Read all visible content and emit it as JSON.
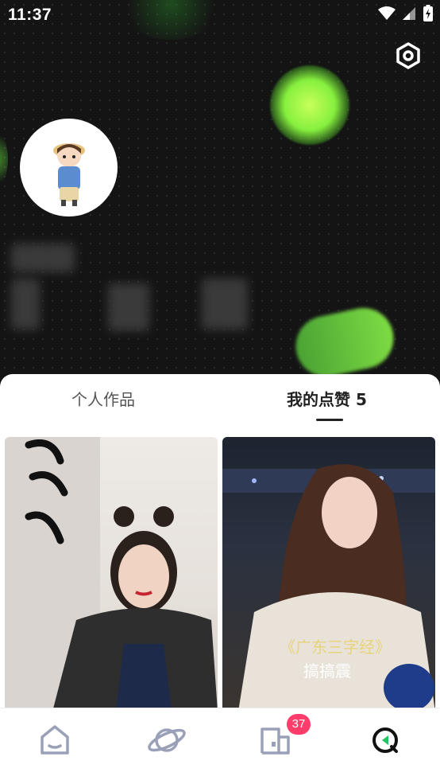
{
  "statusbar": {
    "time": "11:37"
  },
  "profile": {
    "avatar_icon": "cartoon-boy-avatar"
  },
  "tabs": [
    {
      "label": "个人作品",
      "active": false
    },
    {
      "label": "我的点赞 5",
      "active": true
    }
  ],
  "feed": [
    {
      "overlay_text": "",
      "style": "light"
    },
    {
      "overlay_text_title": "《广东三字经》",
      "overlay_text_sub": "搞搞震",
      "style": "night"
    }
  ],
  "navbar": {
    "items": [
      {
        "icon": "home-icon"
      },
      {
        "icon": "planet-icon"
      },
      {
        "icon": "messages-icon",
        "badge": "37"
      },
      {
        "icon": "profile-icon",
        "active": true
      }
    ]
  },
  "colors": {
    "accent": "#ff3c6a",
    "glow": "#86f03e"
  }
}
